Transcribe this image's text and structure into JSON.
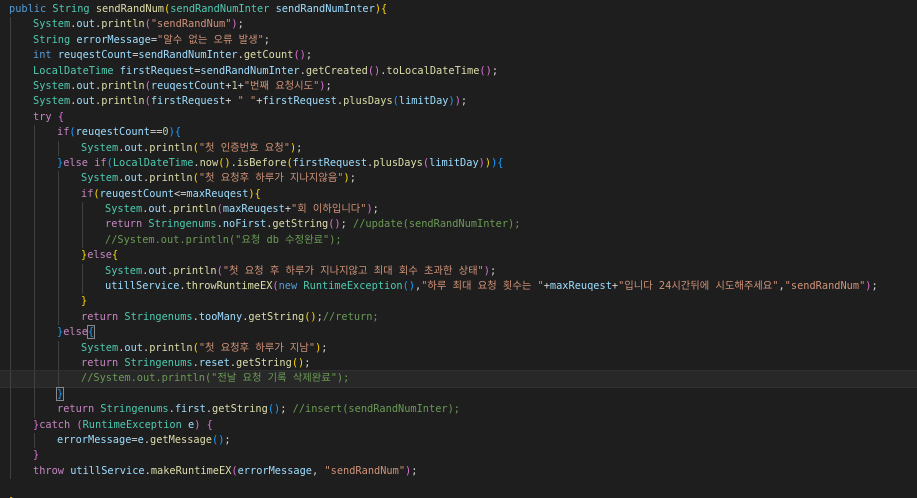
{
  "editor": {
    "lines": [
      {
        "indent": 0,
        "tokens": [
          [
            "public ",
            "kw"
          ],
          [
            "String ",
            "ty"
          ],
          [
            "sendRandNum",
            "fn"
          ],
          [
            "(",
            "br1"
          ],
          [
            "sendRandNumInter ",
            "ty"
          ],
          [
            "sendRandNumInter",
            "var"
          ],
          [
            ")",
            "br1"
          ],
          [
            "{",
            "br1"
          ]
        ]
      },
      {
        "indent": 1,
        "tokens": [
          [
            "System",
            "ty"
          ],
          [
            ".",
            "pu"
          ],
          [
            "out",
            "var"
          ],
          [
            ".",
            "pu"
          ],
          [
            "println",
            "fn"
          ],
          [
            "(",
            "br2"
          ],
          [
            "\"sendRandNum\"",
            "str"
          ],
          [
            ")",
            "br2"
          ],
          [
            ";",
            "pu"
          ]
        ]
      },
      {
        "indent": 1,
        "tokens": [
          [
            "String ",
            "ty"
          ],
          [
            "errorMessage",
            "var"
          ],
          [
            "=",
            "pu"
          ],
          [
            "\"알수 없는 오류 발생\"",
            "str"
          ],
          [
            ";",
            "pu"
          ]
        ]
      },
      {
        "indent": 1,
        "tokens": [
          [
            "int ",
            "kw"
          ],
          [
            "reuqestCount",
            "var"
          ],
          [
            "=",
            "pu"
          ],
          [
            "sendRandNumInter",
            "var"
          ],
          [
            ".",
            "pu"
          ],
          [
            "getCount",
            "fn"
          ],
          [
            "(",
            "br2"
          ],
          [
            ")",
            "br2"
          ],
          [
            ";",
            "pu"
          ]
        ]
      },
      {
        "indent": 1,
        "tokens": [
          [
            "LocalDateTime ",
            "ty"
          ],
          [
            "firstRequest",
            "var"
          ],
          [
            "=",
            "pu"
          ],
          [
            "sendRandNumInter",
            "var"
          ],
          [
            ".",
            "pu"
          ],
          [
            "getCreated",
            "fn"
          ],
          [
            "(",
            "br2"
          ],
          [
            ")",
            "br2"
          ],
          [
            ".",
            "pu"
          ],
          [
            "toLocalDateTime",
            "fn"
          ],
          [
            "(",
            "br2"
          ],
          [
            ")",
            "br2"
          ],
          [
            ";",
            "pu"
          ]
        ]
      },
      {
        "indent": 1,
        "tokens": [
          [
            "System",
            "ty"
          ],
          [
            ".",
            "pu"
          ],
          [
            "out",
            "var"
          ],
          [
            ".",
            "pu"
          ],
          [
            "println",
            "fn"
          ],
          [
            "(",
            "br2"
          ],
          [
            "reuqestCount",
            "var"
          ],
          [
            "+",
            "pu"
          ],
          [
            "1",
            "num"
          ],
          [
            "+",
            "pu"
          ],
          [
            "\"번째 요청시도\"",
            "str"
          ],
          [
            ")",
            "br2"
          ],
          [
            ";",
            "pu"
          ]
        ]
      },
      {
        "indent": 1,
        "tokens": [
          [
            "System",
            "ty"
          ],
          [
            ".",
            "pu"
          ],
          [
            "out",
            "var"
          ],
          [
            ".",
            "pu"
          ],
          [
            "println",
            "fn"
          ],
          [
            "(",
            "br2"
          ],
          [
            "firstRequest",
            "var"
          ],
          [
            "+ ",
            "pu"
          ],
          [
            "\" \"",
            "str"
          ],
          [
            "+",
            "pu"
          ],
          [
            "firstRequest",
            "var"
          ],
          [
            ".",
            "pu"
          ],
          [
            "plusDays",
            "fn"
          ],
          [
            "(",
            "br3"
          ],
          [
            "limitDay",
            "var"
          ],
          [
            ")",
            "br3"
          ],
          [
            ")",
            "br2"
          ],
          [
            ";",
            "pu"
          ]
        ]
      },
      {
        "indent": 1,
        "tokens": [
          [
            "try ",
            "ctl"
          ],
          [
            "{",
            "br2"
          ]
        ]
      },
      {
        "indent": 2,
        "tokens": [
          [
            "if",
            "ctl"
          ],
          [
            "(",
            "br3"
          ],
          [
            "reuqestCount",
            "var"
          ],
          [
            "==",
            "pu"
          ],
          [
            "0",
            "num"
          ],
          [
            ")",
            "br3"
          ],
          [
            "{",
            "br3"
          ]
        ]
      },
      {
        "indent": 3,
        "tokens": [
          [
            "System",
            "ty"
          ],
          [
            ".",
            "pu"
          ],
          [
            "out",
            "var"
          ],
          [
            ".",
            "pu"
          ],
          [
            "println",
            "fn"
          ],
          [
            "(",
            "br1"
          ],
          [
            "\"첫 인증번호 요청\"",
            "str"
          ],
          [
            ")",
            "br1"
          ],
          [
            ";",
            "pu"
          ]
        ]
      },
      {
        "indent": 2,
        "tokens": [
          [
            "}",
            "br3"
          ],
          [
            "else ",
            "ctl"
          ],
          [
            "if",
            "ctl"
          ],
          [
            "(",
            "br3"
          ],
          [
            "LocalDateTime",
            "ty"
          ],
          [
            ".",
            "pu"
          ],
          [
            "now",
            "fn"
          ],
          [
            "(",
            "br1"
          ],
          [
            ")",
            "br1"
          ],
          [
            ".",
            "pu"
          ],
          [
            "isBefore",
            "fn"
          ],
          [
            "(",
            "br1"
          ],
          [
            "firstRequest",
            "var"
          ],
          [
            ".",
            "pu"
          ],
          [
            "plusDays",
            "fn"
          ],
          [
            "(",
            "br2"
          ],
          [
            "limitDay",
            "var"
          ],
          [
            ")",
            "br2"
          ],
          [
            ")",
            "br1"
          ],
          [
            ")",
            "br3"
          ],
          [
            "{",
            "br3"
          ]
        ]
      },
      {
        "indent": 3,
        "tokens": [
          [
            "System",
            "ty"
          ],
          [
            ".",
            "pu"
          ],
          [
            "out",
            "var"
          ],
          [
            ".",
            "pu"
          ],
          [
            "println",
            "fn"
          ],
          [
            "(",
            "br1"
          ],
          [
            "\"첫 요청후 하루가 지나지않음\"",
            "str"
          ],
          [
            ")",
            "br1"
          ],
          [
            ";",
            "pu"
          ]
        ]
      },
      {
        "indent": 3,
        "tokens": [
          [
            "if",
            "ctl"
          ],
          [
            "(",
            "br1"
          ],
          [
            "reuqestCount",
            "var"
          ],
          [
            "<=",
            "pu"
          ],
          [
            "maxReuqest",
            "var"
          ],
          [
            ")",
            "br1"
          ],
          [
            "{",
            "br1"
          ]
        ]
      },
      {
        "indent": 4,
        "tokens": [
          [
            "System",
            "ty"
          ],
          [
            ".",
            "pu"
          ],
          [
            "out",
            "var"
          ],
          [
            ".",
            "pu"
          ],
          [
            "println",
            "fn"
          ],
          [
            "(",
            "br2"
          ],
          [
            "maxReuqest",
            "var"
          ],
          [
            "+",
            "pu"
          ],
          [
            "\"회 이하입니다\"",
            "str"
          ],
          [
            ")",
            "br2"
          ],
          [
            ";",
            "pu"
          ]
        ]
      },
      {
        "indent": 4,
        "tokens": [
          [
            "return ",
            "ctl"
          ],
          [
            "Stringenums",
            "ty"
          ],
          [
            ".",
            "pu"
          ],
          [
            "noFirst",
            "var"
          ],
          [
            ".",
            "pu"
          ],
          [
            "getString",
            "fn"
          ],
          [
            "(",
            "br2"
          ],
          [
            ")",
            "br2"
          ],
          [
            "; ",
            "pu"
          ],
          [
            "//update(sendRandNumInter);",
            "cm"
          ]
        ]
      },
      {
        "indent": 4,
        "tokens": [
          [
            "//System.out.println(\"요청 db 수정완료\");",
            "cm"
          ]
        ]
      },
      {
        "indent": 3,
        "tokens": [
          [
            "}",
            "br1"
          ],
          [
            "else",
            "ctl"
          ],
          [
            "{",
            "br1"
          ]
        ]
      },
      {
        "indent": 4,
        "tokens": [
          [
            "System",
            "ty"
          ],
          [
            ".",
            "pu"
          ],
          [
            "out",
            "var"
          ],
          [
            ".",
            "pu"
          ],
          [
            "println",
            "fn"
          ],
          [
            "(",
            "br2"
          ],
          [
            "\"첫 요청 후 하루가 지나지않고 최대 회수 초과한 상태\"",
            "str"
          ],
          [
            ")",
            "br2"
          ],
          [
            ";",
            "pu"
          ]
        ]
      },
      {
        "indent": 4,
        "tokens": [
          [
            "utillService",
            "var"
          ],
          [
            ".",
            "pu"
          ],
          [
            "throwRuntimeEX",
            "fn"
          ],
          [
            "(",
            "br2"
          ],
          [
            "new ",
            "kw"
          ],
          [
            "RuntimeException",
            "ty"
          ],
          [
            "(",
            "br3"
          ],
          [
            ")",
            "br3"
          ],
          [
            ",",
            "pu"
          ],
          [
            "\"하루 최대 요청 횟수는 \"",
            "str"
          ],
          [
            "+",
            "pu"
          ],
          [
            "maxReuqest",
            "var"
          ],
          [
            "+",
            "pu"
          ],
          [
            "\"입니다 24시간뒤에 시도해주세요\"",
            "str"
          ],
          [
            ",",
            "pu"
          ],
          [
            "\"sendRandNum\"",
            "str"
          ],
          [
            ")",
            "br2"
          ],
          [
            ";",
            "pu"
          ]
        ]
      },
      {
        "indent": 3,
        "tokens": [
          [
            "}",
            "br1"
          ]
        ]
      },
      {
        "indent": 3,
        "tokens": [
          [
            "return ",
            "ctl"
          ],
          [
            "Stringenums",
            "ty"
          ],
          [
            ".",
            "pu"
          ],
          [
            "tooMany",
            "var"
          ],
          [
            ".",
            "pu"
          ],
          [
            "getString",
            "fn"
          ],
          [
            "(",
            "br1"
          ],
          [
            ")",
            "br1"
          ],
          [
            ";",
            "pu"
          ],
          [
            "//return;",
            "cm"
          ]
        ]
      },
      {
        "indent": 2,
        "tokens": [
          [
            "}",
            "br3"
          ],
          [
            "else",
            "ctl"
          ],
          [
            "{",
            "br3 bm"
          ]
        ]
      },
      {
        "indent": 3,
        "tokens": [
          [
            "System",
            "ty"
          ],
          [
            ".",
            "pu"
          ],
          [
            "out",
            "var"
          ],
          [
            ".",
            "pu"
          ],
          [
            "println",
            "fn"
          ],
          [
            "(",
            "br1"
          ],
          [
            "\"첫 요청후 하루가 지남\"",
            "str"
          ],
          [
            ")",
            "br1"
          ],
          [
            ";",
            "pu"
          ]
        ]
      },
      {
        "indent": 3,
        "tokens": [
          [
            "return ",
            "ctl"
          ],
          [
            "Stringenums",
            "ty"
          ],
          [
            ".",
            "pu"
          ],
          [
            "reset",
            "var"
          ],
          [
            ".",
            "pu"
          ],
          [
            "getString",
            "fn"
          ],
          [
            "(",
            "br1"
          ],
          [
            ")",
            "br1"
          ],
          [
            ";",
            "pu"
          ]
        ]
      },
      {
        "indent": 3,
        "current": true,
        "tokens": [
          [
            "//System.out.println(\"전날 요청 기록 삭제완료\");",
            "cm"
          ]
        ]
      },
      {
        "indent": 2,
        "tokens": [
          [
            "}",
            "br3 bm"
          ]
        ]
      },
      {
        "indent": 2,
        "tokens": [
          [
            "return ",
            "ctl"
          ],
          [
            "Stringenums",
            "ty"
          ],
          [
            ".",
            "pu"
          ],
          [
            "first",
            "var"
          ],
          [
            ".",
            "pu"
          ],
          [
            "getString",
            "fn"
          ],
          [
            "(",
            "br3"
          ],
          [
            ")",
            "br3"
          ],
          [
            "; ",
            "pu"
          ],
          [
            "//insert(sendRandNumInter);",
            "cm"
          ]
        ]
      },
      {
        "indent": 1,
        "tokens": [
          [
            "}",
            "br2"
          ],
          [
            "catch ",
            "ctl"
          ],
          [
            "(",
            "br2"
          ],
          [
            "RuntimeException ",
            "ty"
          ],
          [
            "e",
            "var"
          ],
          [
            ") ",
            "br2"
          ],
          [
            "{",
            "br2"
          ]
        ]
      },
      {
        "indent": 2,
        "tokens": [
          [
            "errorMessage",
            "var"
          ],
          [
            "=",
            "pu"
          ],
          [
            "e",
            "var"
          ],
          [
            ".",
            "pu"
          ],
          [
            "getMessage",
            "fn"
          ],
          [
            "(",
            "br3"
          ],
          [
            ")",
            "br3"
          ],
          [
            ";",
            "pu"
          ]
        ]
      },
      {
        "indent": 1,
        "tokens": [
          [
            "}",
            "br2"
          ]
        ]
      },
      {
        "indent": 1,
        "tokens": [
          [
            "throw ",
            "ctl"
          ],
          [
            "utillService",
            "var"
          ],
          [
            ".",
            "pu"
          ],
          [
            "makeRuntimeEX",
            "fn"
          ],
          [
            "(",
            "br2"
          ],
          [
            "errorMessage",
            "var"
          ],
          [
            ", ",
            "pu"
          ],
          [
            "\"sendRandNum\"",
            "str"
          ],
          [
            ")",
            "br2"
          ],
          [
            ";",
            "pu"
          ]
        ]
      },
      {
        "indent": 0,
        "tokens": []
      },
      {
        "indent": 0,
        "tokens": [
          [
            "}",
            "br1"
          ]
        ]
      }
    ]
  }
}
